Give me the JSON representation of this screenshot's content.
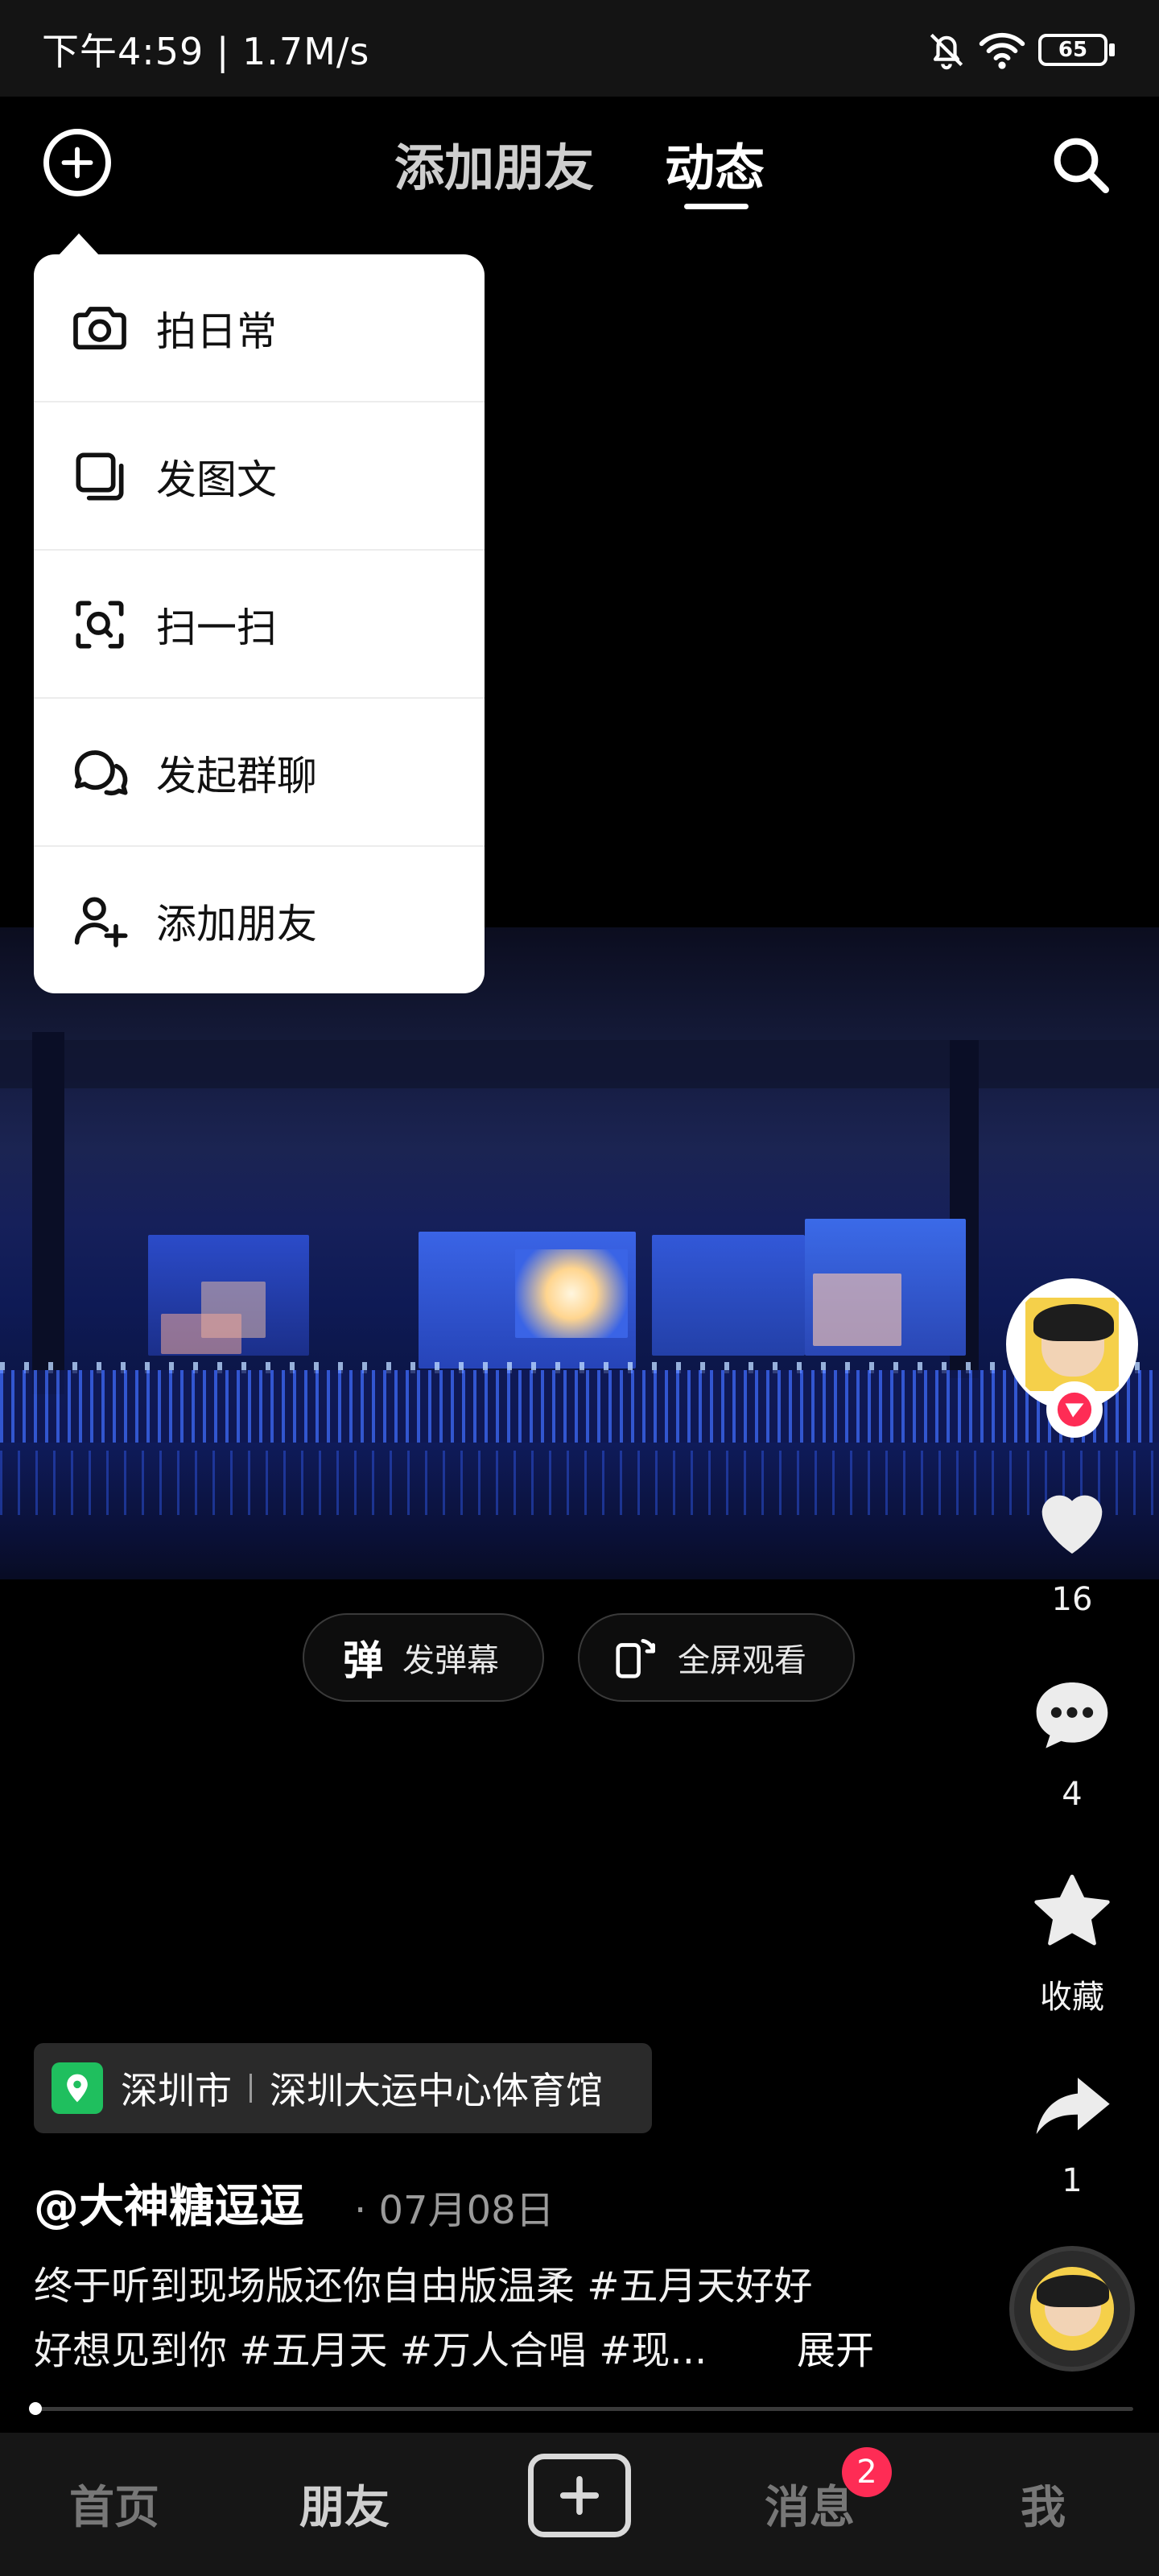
{
  "status_bar": {
    "time_speed": "下午4:59 | 1.7M/s",
    "battery": "65"
  },
  "top_nav": {
    "tabs": [
      {
        "label": "添加朋友"
      },
      {
        "label": "动态"
      }
    ],
    "active_tab": "动态"
  },
  "menu": {
    "items": [
      {
        "label": "拍日常",
        "icon": "camera-icon"
      },
      {
        "label": "发图文",
        "icon": "image-text-icon"
      },
      {
        "label": "扫一扫",
        "icon": "scan-icon"
      },
      {
        "label": "发起群聊",
        "icon": "group-chat-icon"
      },
      {
        "label": "添加朋友",
        "icon": "add-friend-icon"
      }
    ]
  },
  "video_actions": {
    "danmaku_label": "发弹幕",
    "danmaku_icon_text": "弹",
    "fullscreen_label": "全屏观看"
  },
  "rail": {
    "likes": "16",
    "comments": "4",
    "favorite_label": "收藏",
    "shares": "1"
  },
  "location": {
    "city": "深圳市",
    "place": "深圳大运中心体育馆"
  },
  "post": {
    "author": "@大神糖逗逗",
    "date": "· 07月08日",
    "caption_line1": "终于听到现场版还你自由版温柔 #五月天好好",
    "caption_line2": "好想见到你 #五月天 #万人合唱 #现...",
    "expand_label": "展开"
  },
  "bottom_nav": {
    "home": "首页",
    "friends": "朋友",
    "messages": "消息",
    "messages_badge": "2",
    "me": "我"
  },
  "colors": {
    "badge": "#fe2c55",
    "location_pin": "#1fbf5e"
  }
}
